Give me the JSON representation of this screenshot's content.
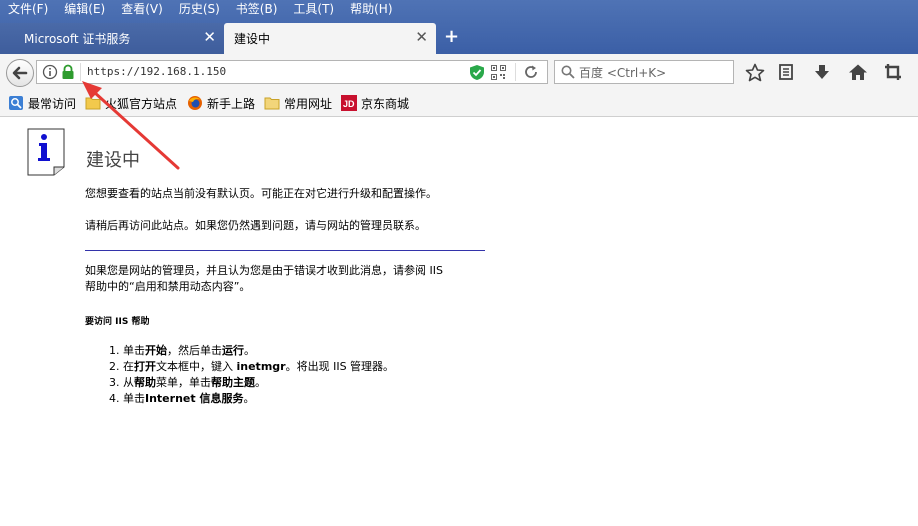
{
  "menu": [
    {
      "label": "文件(F)"
    },
    {
      "label": "编辑(E)"
    },
    {
      "label": "查看(V)"
    },
    {
      "label": "历史(S)"
    },
    {
      "label": "书签(B)"
    },
    {
      "label": "工具(T)"
    },
    {
      "label": "帮助(H)"
    }
  ],
  "tabs": [
    {
      "label": "Microsoft 证书服务",
      "close": "✕"
    },
    {
      "label": "建设中",
      "close": "✕"
    }
  ],
  "new_tab_label": "+",
  "urlbar": {
    "url": "https://192.168.1.150"
  },
  "search": {
    "placeholder": "百度 <Ctrl+K>"
  },
  "bookmarks": [
    {
      "label": "最常访问"
    },
    {
      "label": "火狐官方站点"
    },
    {
      "label": "新手上路"
    },
    {
      "label": "常用网址"
    },
    {
      "label": "京东商城"
    }
  ],
  "page": {
    "title": "建设中",
    "p1": "您想要查看的站点当前没有默认页。可能正在对它进行升级和配置操作。",
    "p2": "请稍后再访问此站点。如果您仍然遇到问题，请与网站的管理员联系。",
    "p3a": "如果您是网站的管理员，并且认为您是由于错误才收到此消息，请参阅 IIS",
    "p3b": "帮助中的“启用和禁用动态内容”。",
    "help_heading": "要访问 IIS 帮助",
    "steps": [
      {
        "pre": "单击",
        "b1": "开始",
        "mid": "，然后单击",
        "b2": "运行",
        "post": "。"
      },
      {
        "pre": "在",
        "b1": "打开",
        "mid": "文本框中，键入 ",
        "b2": "inetmgr",
        "post": "。将出现 IIS 管理器。"
      },
      {
        "pre": "从",
        "b1": "帮助",
        "mid": "菜单，单击",
        "b2": "帮助主题",
        "post": "。"
      },
      {
        "pre": "单击",
        "b1": "Internet 信息服务",
        "mid": "",
        "b2": "",
        "post": "。"
      }
    ]
  },
  "colors": {
    "accent": "#3b5fa6",
    "secure": "#2e9b2e",
    "annotation_arrow": "#e53935"
  }
}
